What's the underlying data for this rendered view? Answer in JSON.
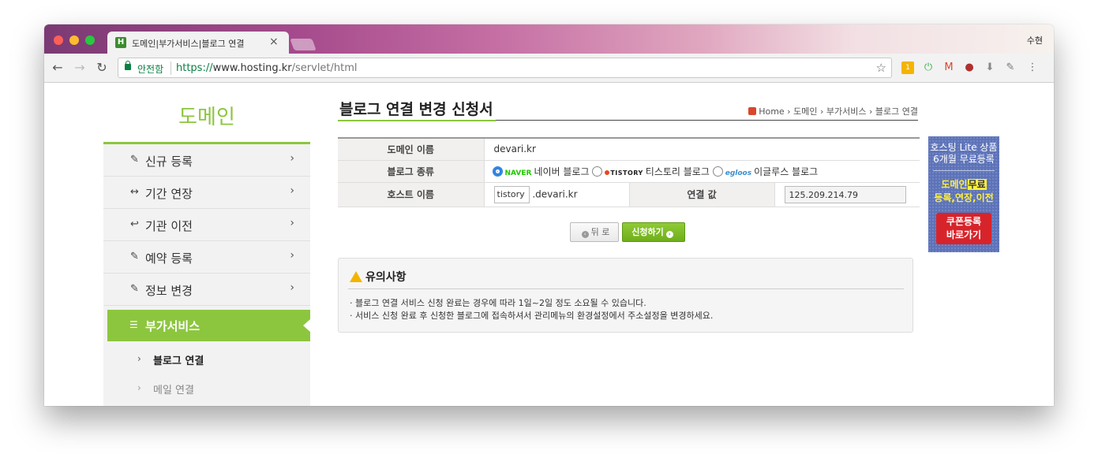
{
  "browser": {
    "tab_title": "도메인|부가서비스|블로그 연결",
    "profile_name": "수현",
    "secure_label": "안전함",
    "url_proto": "https://",
    "url_host": "www.hosting.kr",
    "url_path": "/servlet/html"
  },
  "sidebar": {
    "title": "도메인",
    "items": [
      {
        "label": "신규 등록",
        "icon": "edit-icon"
      },
      {
        "label": "기간 연장",
        "icon": "arrows-horizontal-icon"
      },
      {
        "label": "기관 이전",
        "icon": "reply-icon"
      },
      {
        "label": "예약 등록",
        "icon": "edit-icon"
      },
      {
        "label": "정보 변경",
        "icon": "edit-icon"
      }
    ],
    "active": {
      "label": "부가서비스",
      "icon": "sliders-icon"
    },
    "subitems": [
      {
        "label": "블로그 연결",
        "active": true
      },
      {
        "label": "메일 연결",
        "active": false
      }
    ]
  },
  "main": {
    "title": "블로그 연결 변경 신청서",
    "breadcrumb": [
      "Home",
      "도메인",
      "부가서비스",
      "블로그 연결"
    ],
    "form": {
      "domain_label": "도메인 이름",
      "domain_value": "devari.kr",
      "blog_type_label": "블로그 종류",
      "blog_options": [
        {
          "logo": "NAVER",
          "label": "네이버 블로그",
          "selected": true
        },
        {
          "logo": "TISTORY",
          "label": "티스토리 블로그",
          "selected": false
        },
        {
          "logo": "egloos",
          "label": "이글루스 블로그",
          "selected": false
        }
      ],
      "host_label": "호스트 이름",
      "host_value": "tistory",
      "host_suffix": ".devari.kr",
      "link_value_label": "연결 값",
      "link_value": "125.209.214.79"
    },
    "buttons": {
      "back": "뒤 로",
      "apply": "신청하기"
    },
    "notice": {
      "title": "유의사항",
      "lines": [
        "· 블로그 연결 서비스 신청 완료는 경우에 따라 1일~2일 정도 소요될 수 있습니다.",
        "· 서비스 신청 완료 후 신청한 블로그에 접속하셔서 관리메뉴의 환경설정에서 주소설정을 변경하세요."
      ]
    }
  },
  "banner": {
    "line1": "호스팅 Lite 상품",
    "line2": "6개월 무료등록",
    "line3a": "도메인",
    "line3b": "무료",
    "line4": "등록,연장,이전",
    "button1": "쿠폰등록",
    "button2": "바로가기"
  },
  "colors": {
    "accent": "#8cc63e",
    "secure": "#0b8043",
    "banner_bg": "#5d73b9",
    "banner_button": "#d7242b"
  }
}
